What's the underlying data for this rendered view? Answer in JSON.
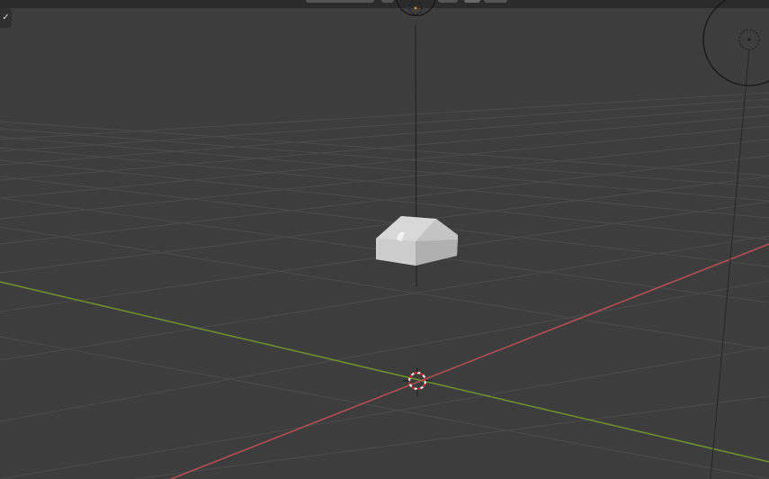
{
  "viewport": {
    "background": "#3d3d3d",
    "grid_color": "#4c4c4c",
    "x_axis_color": "#b34e52",
    "y_axis_color": "#6c8e2f",
    "object_color": "#c9c9c9"
  },
  "overlay_toggle": {
    "icon": "checkmark-icon",
    "glyph": "✓"
  },
  "scene": {
    "object": "mesh-object",
    "cursor": "3d-cursor",
    "lights": [
      "light-top",
      "light-right"
    ]
  }
}
